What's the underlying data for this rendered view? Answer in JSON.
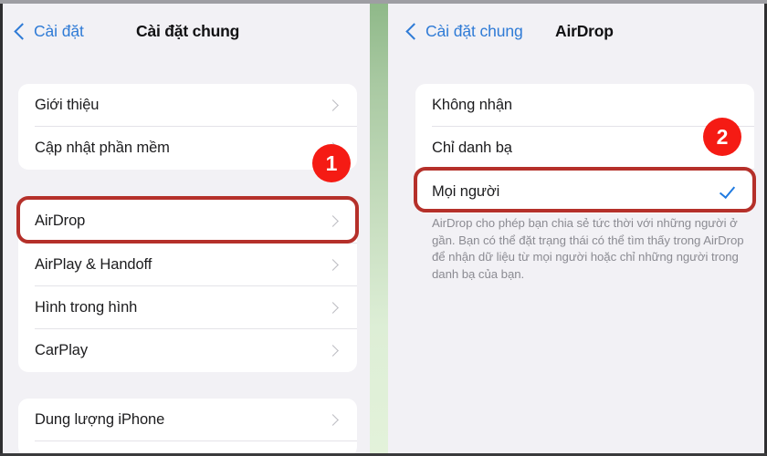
{
  "theme": {
    "background": "#f2f1f5",
    "card": "#ffffff",
    "accent_blue": "#2f7bd6",
    "badge_red": "#f51b14",
    "outline_red": "#b5302a",
    "separator_green_top": "#8fb989",
    "separator_green_bottom": "#e3f2da"
  },
  "left_panel": {
    "nav": {
      "back_label": "Cài đặt",
      "title": "Cài đặt chung",
      "back_icon": "chevron-left-icon"
    },
    "groups": [
      {
        "rows": [
          {
            "label": "Giới thiệu",
            "accessory": "chevron-right-icon"
          },
          {
            "label": "Cập nhật phần mềm",
            "accessory": "chevron-right-icon"
          }
        ]
      },
      {
        "rows": [
          {
            "label": "AirDrop",
            "accessory": "chevron-right-icon",
            "highlighted": true
          },
          {
            "label": "AirPlay & Handoff",
            "accessory": "chevron-right-icon"
          },
          {
            "label": "Hình trong hình",
            "accessory": "chevron-right-icon"
          },
          {
            "label": "CarPlay",
            "accessory": "chevron-right-icon"
          }
        ]
      },
      {
        "rows": [
          {
            "label": "Dung lượng iPhone",
            "accessory": "chevron-right-icon"
          }
        ]
      }
    ],
    "badge": "1"
  },
  "right_panel": {
    "nav": {
      "back_label": "Cài đặt chung",
      "title": "AirDrop",
      "back_icon": "chevron-left-icon"
    },
    "options": [
      {
        "label": "Không nhận",
        "selected": false
      },
      {
        "label": "Chỉ danh bạ",
        "selected": false
      },
      {
        "label": "Mọi người",
        "selected": true,
        "accessory": "checkmark-icon",
        "highlighted": true
      }
    ],
    "footer_note": "AirDrop cho phép bạn chia sẻ tức thời với những người ở gần. Bạn có thể đặt trạng thái có thể tìm thấy trong AirDrop để nhận dữ liệu từ mọi người hoặc chỉ những người trong danh bạ của bạn.",
    "badge": "2"
  }
}
